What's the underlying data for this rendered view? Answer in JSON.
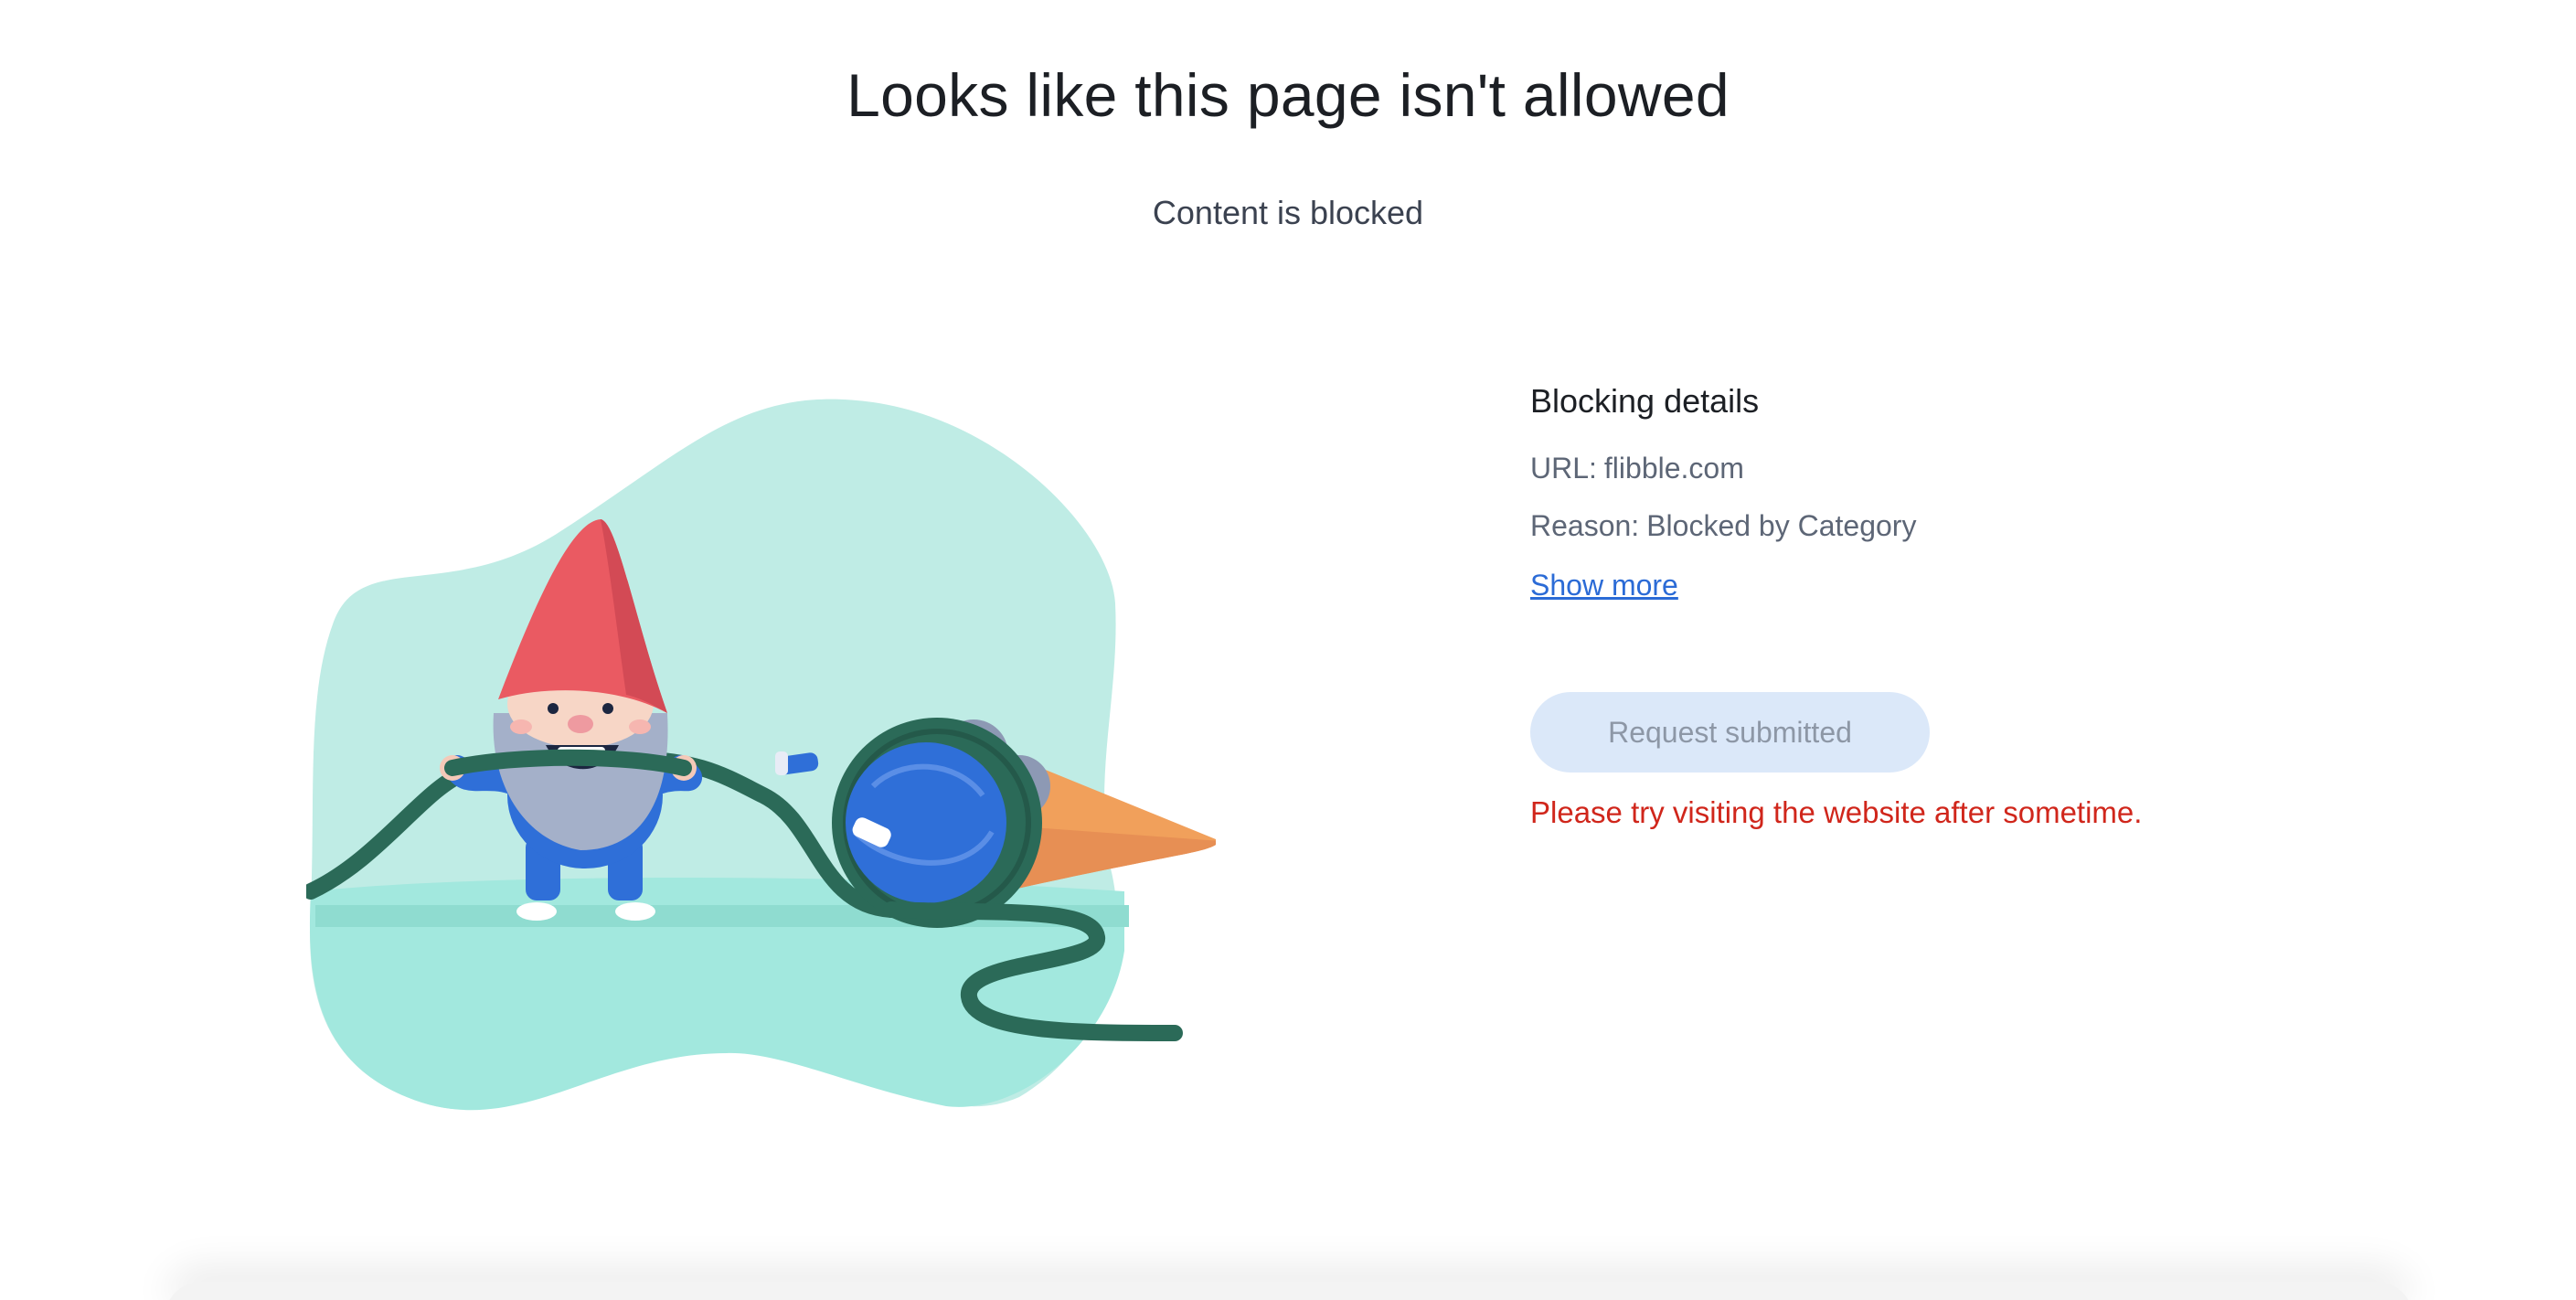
{
  "header": {
    "title": "Looks like this page isn't allowed",
    "subtitle": "Content is blocked"
  },
  "illustration": {
    "icon": "gnome-pulling-hose-illustration",
    "colors": {
      "blob": "#bfece5",
      "ground": "#a2e8de",
      "hat": "#ea5a62",
      "hose": "#2b6a58",
      "ball": "#2f6fd8",
      "cone": "#f1a05b"
    }
  },
  "details": {
    "heading": "Blocking details",
    "url_label": "URL:",
    "url_value": "flibble.com",
    "reason_label": "Reason:",
    "reason_value": "Blocked by Category",
    "show_more": "Show more"
  },
  "request": {
    "button_label": "Request submitted",
    "message": "Please try visiting the website after sometime."
  },
  "colors": {
    "link": "#2b6bd6",
    "error": "#d0261b",
    "button_bg": "#dbe8f9"
  }
}
